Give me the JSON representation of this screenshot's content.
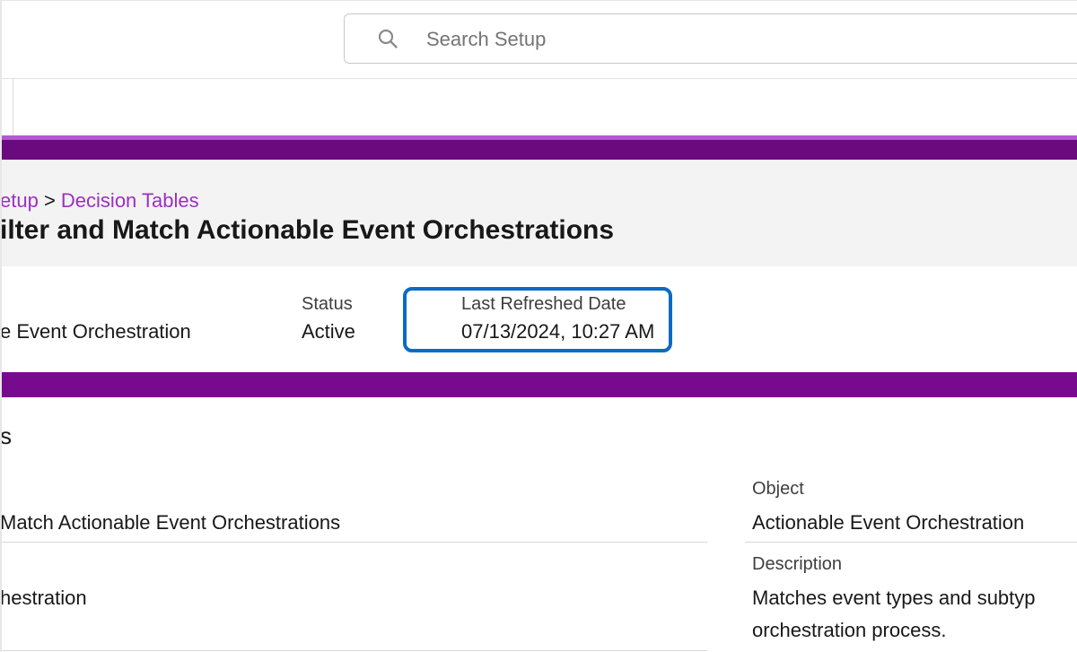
{
  "search": {
    "placeholder": "Search Setup",
    "icon": "search-icon"
  },
  "breadcrumb": {
    "parent": "etup",
    "separator": ">",
    "current": "Decision Tables"
  },
  "page_title": "ilter and Match Actionable Event Orchestrations",
  "fields": {
    "type_value": "e Event Orchestration",
    "status_label": "Status",
    "status_value": "Active",
    "refreshed_label": "Last Refreshed Date",
    "refreshed_value": "07/13/2024, 10:27 AM"
  },
  "detail": {
    "section_heading": "s",
    "name_value": " Match Actionable Event Orchestrations",
    "type_value": "hestration",
    "object_label": "Object",
    "object_value": "Actionable Event Orchestration",
    "description_label": "Description",
    "description_line1": "Matches event types and subtyp",
    "description_line2": "orchestration process."
  },
  "colors": {
    "brand_purple": "#6b0a7f",
    "link_purple": "#9b30c1",
    "highlight_blue": "#0b6bc4"
  }
}
